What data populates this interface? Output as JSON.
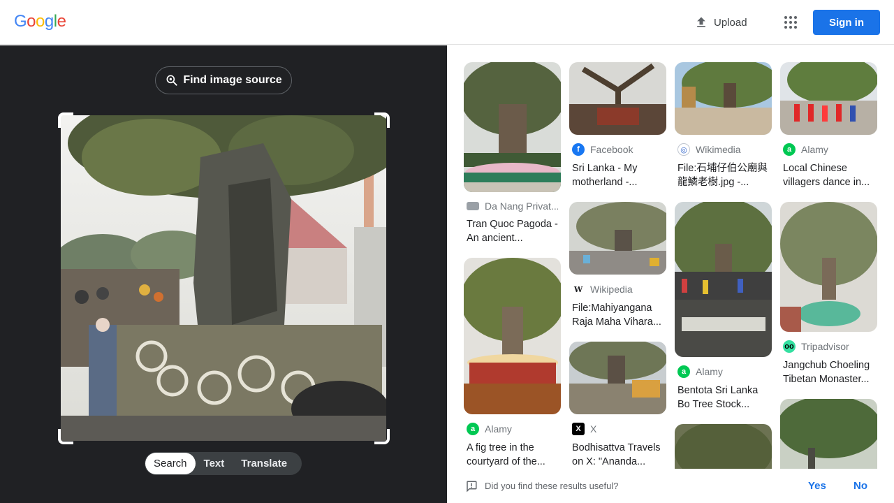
{
  "header": {
    "logo": [
      "G",
      "o",
      "o",
      "g",
      "l",
      "e"
    ],
    "logo_colors": [
      "#4285f4",
      "#ea4335",
      "#fbbc05",
      "#4285f4",
      "#34a853",
      "#ea4335"
    ],
    "upload_label": "Upload",
    "apps_icon": "apps-grid-icon",
    "signin_label": "Sign in"
  },
  "left": {
    "find_source_label": "Find image source",
    "query_image": "tree with swastika-patterned fence at temple",
    "tabs": [
      {
        "label": "Search",
        "active": true
      },
      {
        "label": "Text",
        "active": false
      },
      {
        "label": "Translate",
        "active": false
      }
    ]
  },
  "results": [
    {
      "source": "Da Nang Privat...",
      "title": "Tran Quoc Pagoda - An ancient...",
      "favicon_color": "#9aa0a6"
    },
    {
      "source": "Alamy",
      "title": "A fig tree in the courtyard of the...",
      "favicon_color": "#00c853"
    },
    {
      "source": "Facebook",
      "title": "Sri Lanka - My motherland -...",
      "favicon_color": "#1877f2"
    },
    {
      "source": "Wikipedia",
      "title": "File:Mahiyangana Raja Maha Vihara...",
      "favicon_color": "#202124"
    },
    {
      "source": "X",
      "title": "Bodhisattva Travels on X: \"Ananda...",
      "favicon_color": "#000000"
    },
    {
      "source": "Wikimedia",
      "title": "File:石埔仔伯公廟與龍鱗老樹.jpg -...",
      "favicon_color": "#3366cc"
    },
    {
      "source": "Alamy",
      "title": "Bentota Sri Lanka Bo Tree Stock...",
      "favicon_color": "#00c853"
    },
    {
      "source": "Alamy",
      "title": "Local Chinese villagers dance in...",
      "favicon_color": "#00c853"
    },
    {
      "source": "Tripadvisor",
      "title": "Jangchub Choeling Tibetan Monaster...",
      "favicon_color": "#34e0a1"
    }
  ],
  "feedback": {
    "question": "Did you find these results useful?",
    "yes": "Yes",
    "no": "No"
  }
}
